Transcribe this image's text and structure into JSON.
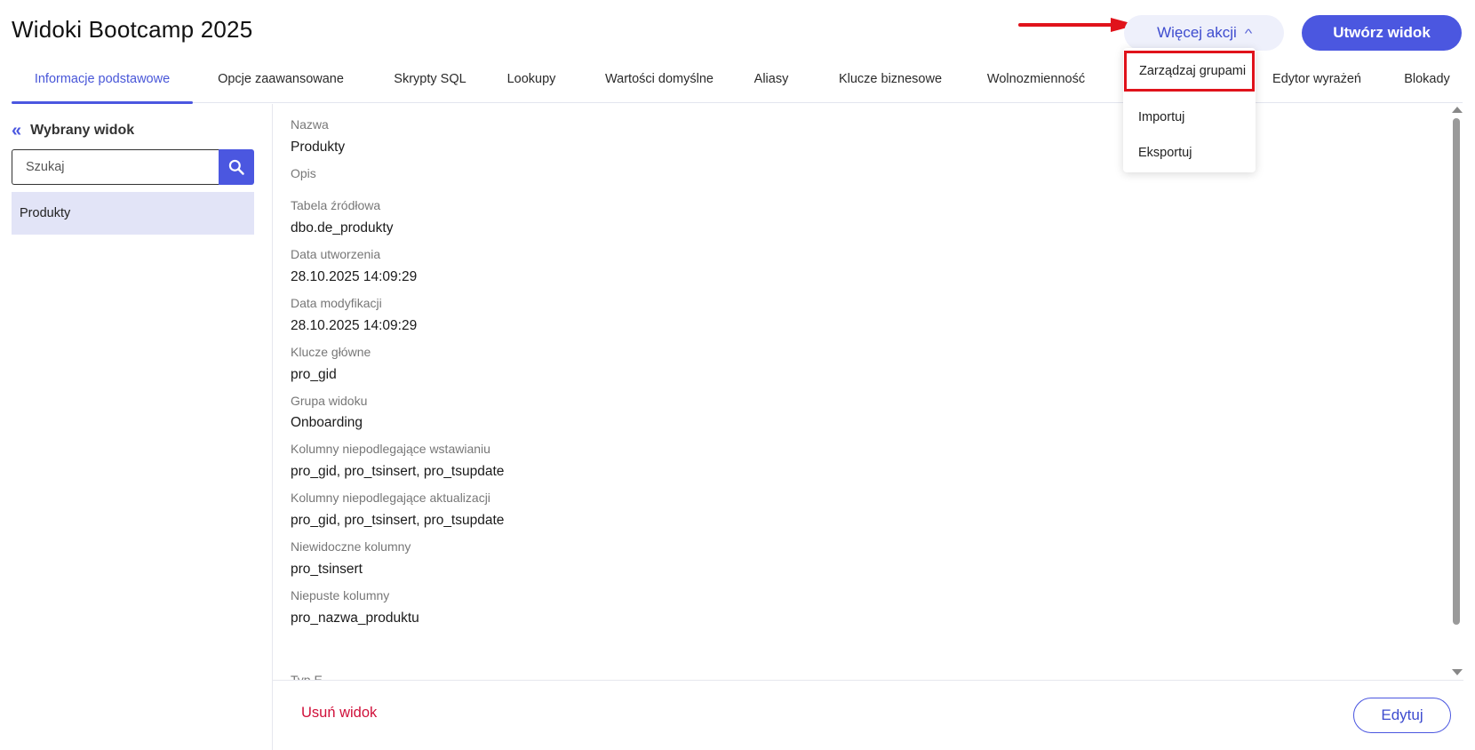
{
  "header": {
    "title": "Widoki Bootcamp 2025",
    "more_actions_label": "Więcej akcji",
    "create_label": "Utwórz widok"
  },
  "annotation": {
    "arrow_color": "#e0131b",
    "highlight_color": "#e0131b"
  },
  "tabs": [
    {
      "label": "Informacje podstawowe",
      "active": true
    },
    {
      "label": "Opcje zaawansowane"
    },
    {
      "label": "Skrypty SQL"
    },
    {
      "label": "Lookupy"
    },
    {
      "label": "Wartości domyślne"
    },
    {
      "label": "Aliasy"
    },
    {
      "label": "Klucze biznesowe"
    },
    {
      "label": "Wolnozmienność"
    },
    {
      "label": "Edytor wyrażeń"
    },
    {
      "label": "Blokady"
    }
  ],
  "dropdown": {
    "items": [
      {
        "label": "Zarządzaj grupami",
        "highlighted": true
      },
      {
        "label": "Importuj"
      },
      {
        "label": "Eksportuj"
      }
    ]
  },
  "sidebar": {
    "title": "Wybrany widok",
    "search_placeholder": "Szukaj",
    "items": [
      "Produkty"
    ]
  },
  "details": {
    "fields": [
      {
        "label": "Nazwa",
        "value": "Produkty"
      },
      {
        "label": "Opis",
        "value": ""
      },
      {
        "label": "Tabela źródłowa",
        "value": "dbo.de_produkty"
      },
      {
        "label": "Data utworzenia",
        "value": "28.10.2025 14:09:29"
      },
      {
        "label": "Data modyfikacji",
        "value": "28.10.2025 14:09:29"
      },
      {
        "label": "Klucze główne",
        "value": "pro_gid"
      },
      {
        "label": "Grupa widoku",
        "value": "Onboarding"
      },
      {
        "label": "Kolumny niepodlegające wstawianiu",
        "value": "pro_gid, pro_tsinsert, pro_tsupdate"
      },
      {
        "label": "Kolumny niepodlegające aktualizacji",
        "value": "pro_gid, pro_tsinsert, pro_tsupdate"
      },
      {
        "label": "Niewidoczne kolumny",
        "value": "pro_tsinsert"
      },
      {
        "label": "Niepuste kolumny",
        "value": "pro_nazwa_produktu"
      },
      {
        "label": "Typ E",
        "value": ""
      }
    ]
  },
  "footer": {
    "delete_label": "Usuń widok",
    "edit_label": "Edytuj"
  },
  "colors": {
    "accent": "#4b57e0",
    "accent_light": "#eef0fb",
    "selected_row": "#e2e4f7",
    "danger": "#d0103a"
  }
}
